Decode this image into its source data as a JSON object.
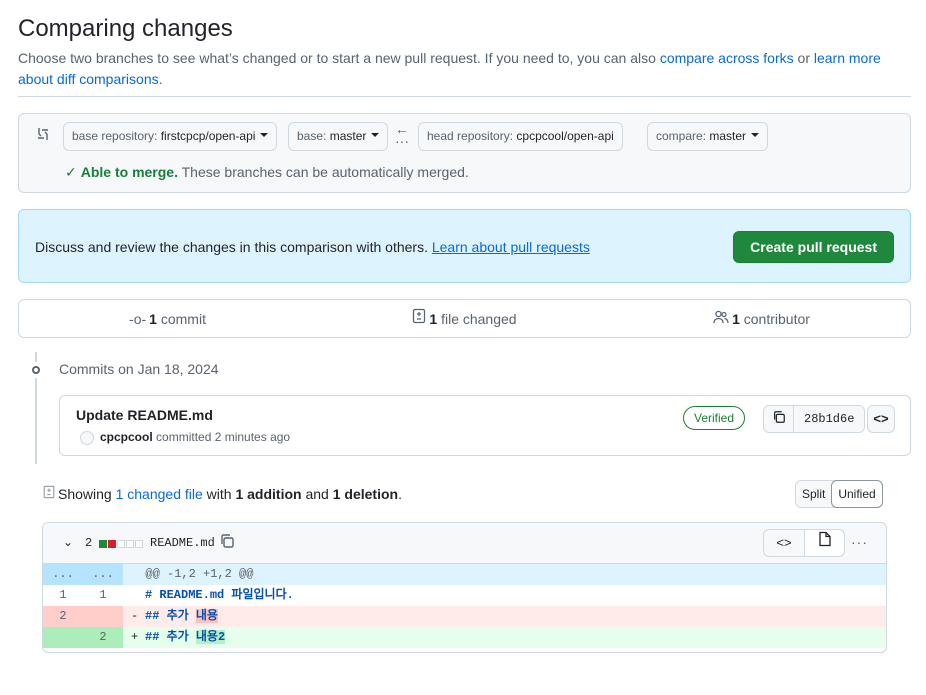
{
  "page": {
    "title": "Comparing changes",
    "intro_text": "Choose two branches to see what’s changed or to start a new pull request. If you need to, you can also ",
    "intro_link1": "compare across forks",
    "intro_or": " or ",
    "intro_link2": "learn more about diff comparisons",
    "intro_end": "."
  },
  "range": {
    "base_repo_label": "base repository: ",
    "base_repo": "firstcpcp/open-api",
    "base_label": "base: ",
    "base": "master",
    "head_repo_label": "head repository: ",
    "head_repo": "cpcpcool/open-api",
    "compare_label": "compare: ",
    "compare": "master",
    "merge_ok": "Able to merge.",
    "merge_text": " These branches can be automatically merged."
  },
  "flash": {
    "text": "Discuss and review the changes in this comparison with others. ",
    "link": "Learn about pull requests",
    "button": "Create pull request"
  },
  "summary": {
    "commits_count": "1",
    "commits_label": " commit",
    "files_count": "1",
    "files_label": " file changed",
    "contributors_count": "1",
    "contributors_label": " contributor"
  },
  "commits": {
    "date_heading": "Commits on Jan 18, 2024",
    "title": "Update README.md",
    "author": "cpcpcool",
    "meta": " committed 2 minutes ago",
    "verified": "Verified",
    "sha": "28b1d6e"
  },
  "diffstat": {
    "showing": "Showing ",
    "changed_link": "1 changed file",
    "with": " with ",
    "additions": "1 addition",
    "and": " and ",
    "deletions": "1 deletion",
    "end": ".",
    "split": "Split",
    "unified": "Unified"
  },
  "file": {
    "count": "2",
    "name": "README.md",
    "hunk_left": "...",
    "hunk_right": "...",
    "hunk": "@@ -1,2 +1,2 @@",
    "lines": [
      {
        "old": "1",
        "new": "1",
        "sign": " ",
        "hash": "#",
        "text": " README.md 파일입니다."
      },
      {
        "old": "2",
        "new": "",
        "sign": "-",
        "hash": "##",
        "pre": " 추가 ",
        "hl": "내용",
        "post": ""
      },
      {
        "old": "",
        "new": "2",
        "sign": "+",
        "hash": "##",
        "pre": " 추가 ",
        "hl": "내용2",
        "post": ""
      }
    ]
  },
  "colors": {
    "accent": "#0969da",
    "success": "#1f883d",
    "danger": "#cf222e"
  }
}
